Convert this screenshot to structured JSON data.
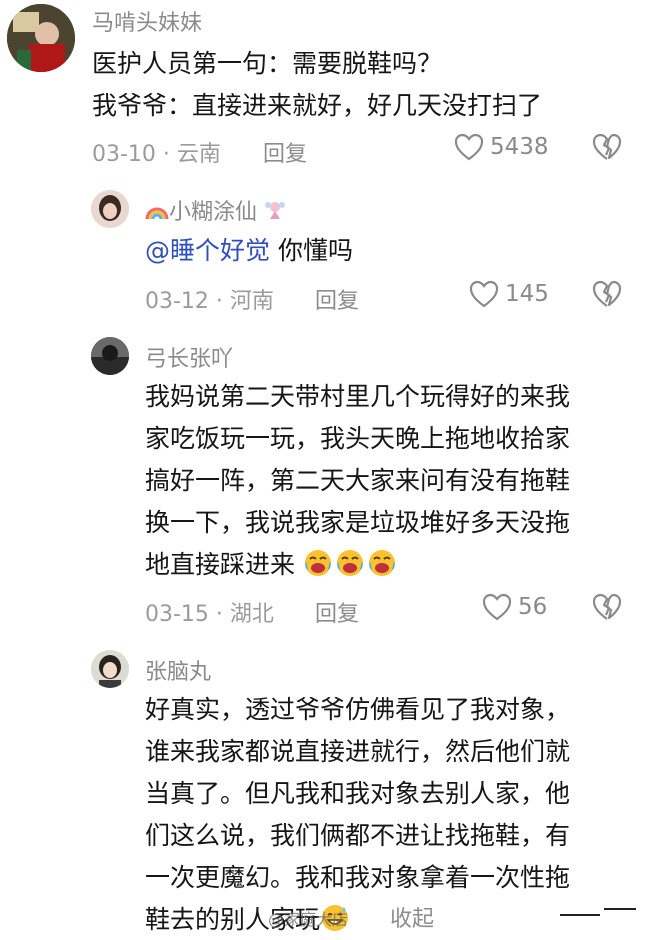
{
  "comments": [
    {
      "username": "马啃头妹妹",
      "lines": [
        "医护人员第一句：需要脱鞋吗？",
        "我爷爷：直接进来就好，好几天没打扫了"
      ],
      "date": "03-10 · 云南",
      "reply_label": "回复",
      "likes": "5438"
    },
    {
      "username": "小糊涂仙",
      "mention": "@睡个好觉",
      "text_after_mention": " 你懂吗",
      "date": "03-12 · 河南",
      "reply_label": "回复",
      "likes": "145"
    },
    {
      "username": "弓长张吖",
      "lines": [
        "我妈说第二天带村里几个玩得好的来我",
        "家吃饭玩一玩，我头天晚上拖地收拾家",
        "搞好一阵，第二天大家来问有没有拖鞋",
        "换一下，我说我家是垃圾堆好多天没拖",
        "地直接踩进来"
      ],
      "emoji_count_label": "😭😭😭",
      "date": "03-15 · 湖北",
      "reply_label": "回复",
      "likes": "56"
    },
    {
      "username": "张脑丸",
      "lines": [
        "好真实，透过爷爷仿佛看见了我对象，",
        "谁来我家都说直接进就行，然后他们就",
        "当真了。但凡我和我对象去别人家，他",
        "们这么说，我们俩都不进让找拖鞋，有",
        "一次更魔幻。我和我对象拿着一次性拖",
        "鞋去的别人家玩"
      ],
      "collapse_label": "收起"
    }
  ],
  "watermark": "@家庭大店",
  "colors": {
    "username": "#8a8a8a",
    "meta": "#9b9b9b",
    "mention": "#2f4fbf",
    "text": "#161616"
  }
}
